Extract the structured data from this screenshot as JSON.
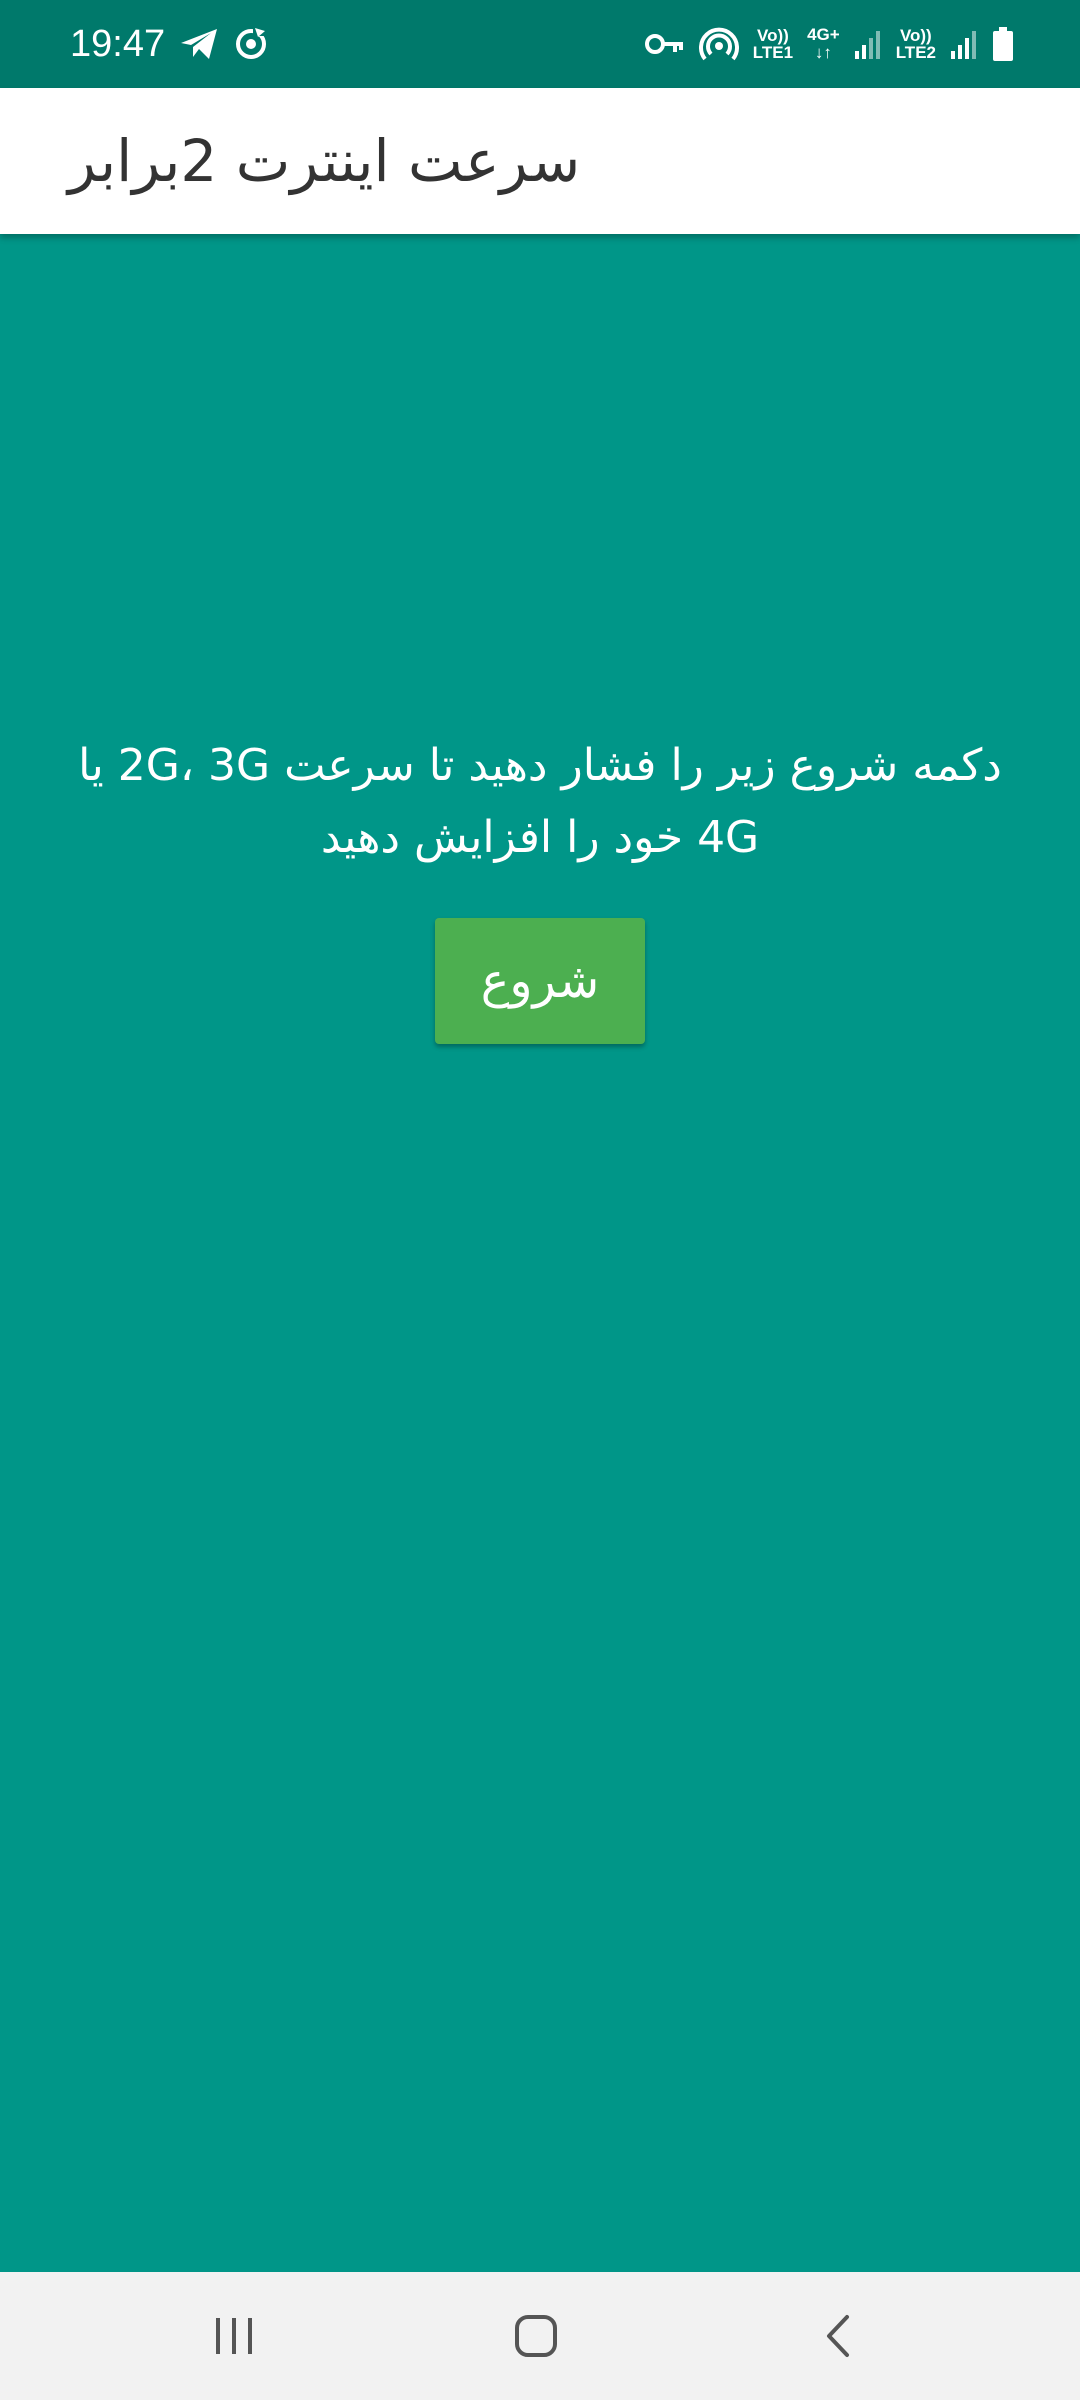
{
  "status_bar": {
    "time": "19:47",
    "sim1_label_top": "Vo))",
    "sim1_label_bottom": "LTE1",
    "net_label_top": "4G+",
    "net_label_bottom": "↓↑",
    "sim2_label_top": "Vo))",
    "sim2_label_bottom": "LTE2",
    "icons": [
      "telegram-icon",
      "sync-icon",
      "vpn-key-icon",
      "hotspot-icon",
      "signal-icon",
      "battery-icon"
    ]
  },
  "app_bar": {
    "title": "سرعت اینترت 2برابر"
  },
  "content": {
    "instruction_line1": "دکمه شروع زیر را فشار دهید تا سرعت 2G، 3G یا",
    "instruction_line2": "4G خود را افزایش دهید",
    "start_button_label": "شروع"
  },
  "nav_bar": {
    "icons": [
      "recent-apps-icon",
      "home-icon",
      "back-icon"
    ]
  },
  "colors": {
    "status_bar": "#00796B",
    "background": "#009688",
    "app_bar": "#ffffff",
    "button": "#4CAF50",
    "nav_bar": "#f2f2f2"
  }
}
